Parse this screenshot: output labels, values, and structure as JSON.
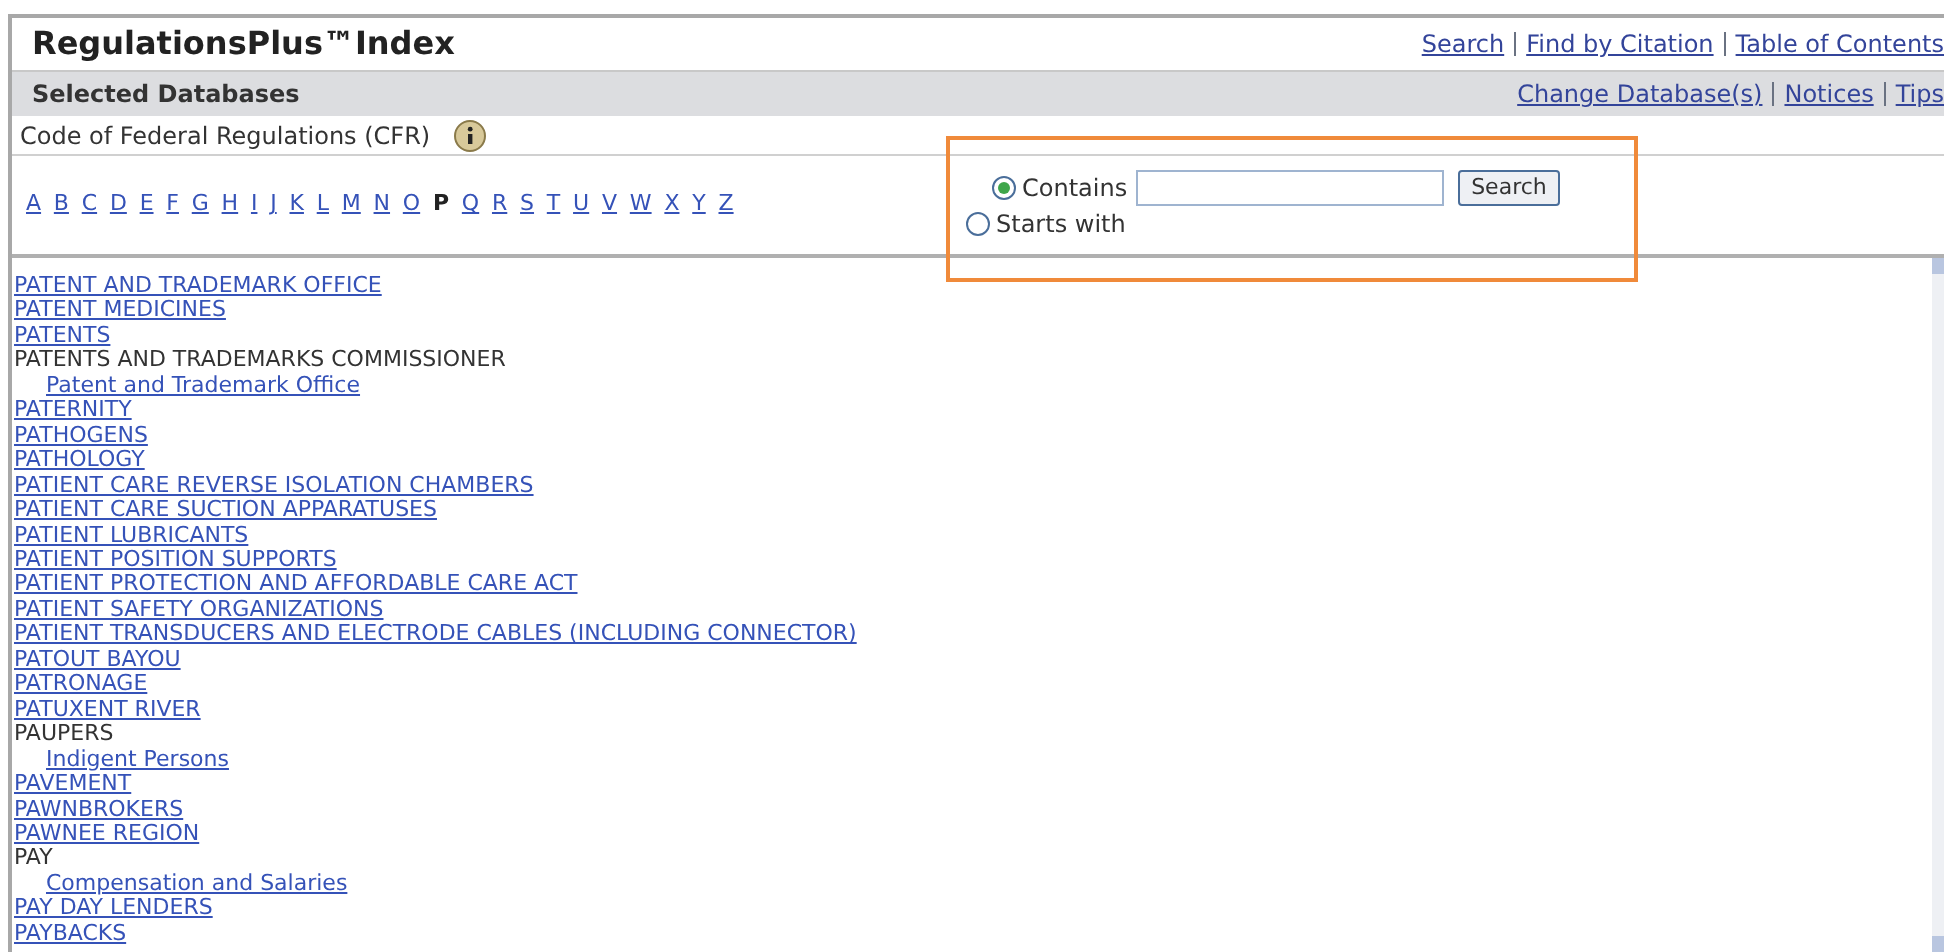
{
  "header": {
    "title": "RegulationsPlus™Index",
    "links": [
      "Search",
      "Find by Citation",
      "Table of Contents"
    ]
  },
  "database_bar": {
    "title": "Selected Databases",
    "links": [
      "Change Database(s)",
      "Notices",
      "Tips"
    ]
  },
  "database": {
    "name": "Code of Federal Regulations (CFR)"
  },
  "letters": [
    {
      "label": "A",
      "selected": false
    },
    {
      "label": "B",
      "selected": false
    },
    {
      "label": "C",
      "selected": false
    },
    {
      "label": "D",
      "selected": false
    },
    {
      "label": "E",
      "selected": false
    },
    {
      "label": "F",
      "selected": false
    },
    {
      "label": "G",
      "selected": false
    },
    {
      "label": "H",
      "selected": false
    },
    {
      "label": "I",
      "selected": false
    },
    {
      "label": "J",
      "selected": false
    },
    {
      "label": "K",
      "selected": false
    },
    {
      "label": "L",
      "selected": false
    },
    {
      "label": "M",
      "selected": false
    },
    {
      "label": "N",
      "selected": false
    },
    {
      "label": "O",
      "selected": false
    },
    {
      "label": "P",
      "selected": true
    },
    {
      "label": "Q",
      "selected": false
    },
    {
      "label": "R",
      "selected": false
    },
    {
      "label": "S",
      "selected": false
    },
    {
      "label": "T",
      "selected": false
    },
    {
      "label": "U",
      "selected": false
    },
    {
      "label": "V",
      "selected": false
    },
    {
      "label": "W",
      "selected": false
    },
    {
      "label": "X",
      "selected": false
    },
    {
      "label": "Y",
      "selected": false
    },
    {
      "label": "Z",
      "selected": false
    }
  ],
  "search": {
    "modes": [
      {
        "label": "Contains",
        "selected": true
      },
      {
        "label": "Starts with",
        "selected": false
      }
    ],
    "button": "Search"
  },
  "index": [
    {
      "label": "PATENT AND TRADEMARK OFFICE",
      "kind": "link"
    },
    {
      "label": "PATENT MEDICINES",
      "kind": "link"
    },
    {
      "label": "PATENTS",
      "kind": "link"
    },
    {
      "label": "PATENTS AND TRADEMARKS COMMISSIONER",
      "kind": "heading",
      "children": [
        {
          "label": "Patent and Trademark Office",
          "kind": "link"
        }
      ]
    },
    {
      "label": "PATERNITY",
      "kind": "link"
    },
    {
      "label": "PATHOGENS",
      "kind": "link"
    },
    {
      "label": "PATHOLOGY",
      "kind": "link"
    },
    {
      "label": "PATIENT CARE REVERSE ISOLATION CHAMBERS",
      "kind": "link"
    },
    {
      "label": "PATIENT CARE SUCTION APPARATUSES",
      "kind": "link"
    },
    {
      "label": "PATIENT LUBRICANTS",
      "kind": "link"
    },
    {
      "label": "PATIENT POSITION SUPPORTS",
      "kind": "link"
    },
    {
      "label": "PATIENT PROTECTION AND AFFORDABLE CARE ACT",
      "kind": "link"
    },
    {
      "label": "PATIENT SAFETY ORGANIZATIONS",
      "kind": "link"
    },
    {
      "label": "PATIENT TRANSDUCERS AND ELECTRODE CABLES (INCLUDING CONNECTOR)",
      "kind": "link"
    },
    {
      "label": "PATOUT BAYOU",
      "kind": "link"
    },
    {
      "label": "PATRONAGE",
      "kind": "link"
    },
    {
      "label": "PATUXENT RIVER",
      "kind": "link"
    },
    {
      "label": "PAUPERS",
      "kind": "heading",
      "children": [
        {
          "label": "Indigent Persons",
          "kind": "link"
        }
      ]
    },
    {
      "label": "PAVEMENT",
      "kind": "link"
    },
    {
      "label": "PAWNBROKERS",
      "kind": "link"
    },
    {
      "label": "PAWNEE REGION",
      "kind": "link"
    },
    {
      "label": "PAY",
      "kind": "heading",
      "children": [
        {
          "label": "Compensation and Salaries",
          "kind": "link"
        }
      ]
    },
    {
      "label": "PAY DAY LENDERS",
      "kind": "link"
    },
    {
      "label": "PAYBACKS",
      "kind": "link"
    }
  ]
}
